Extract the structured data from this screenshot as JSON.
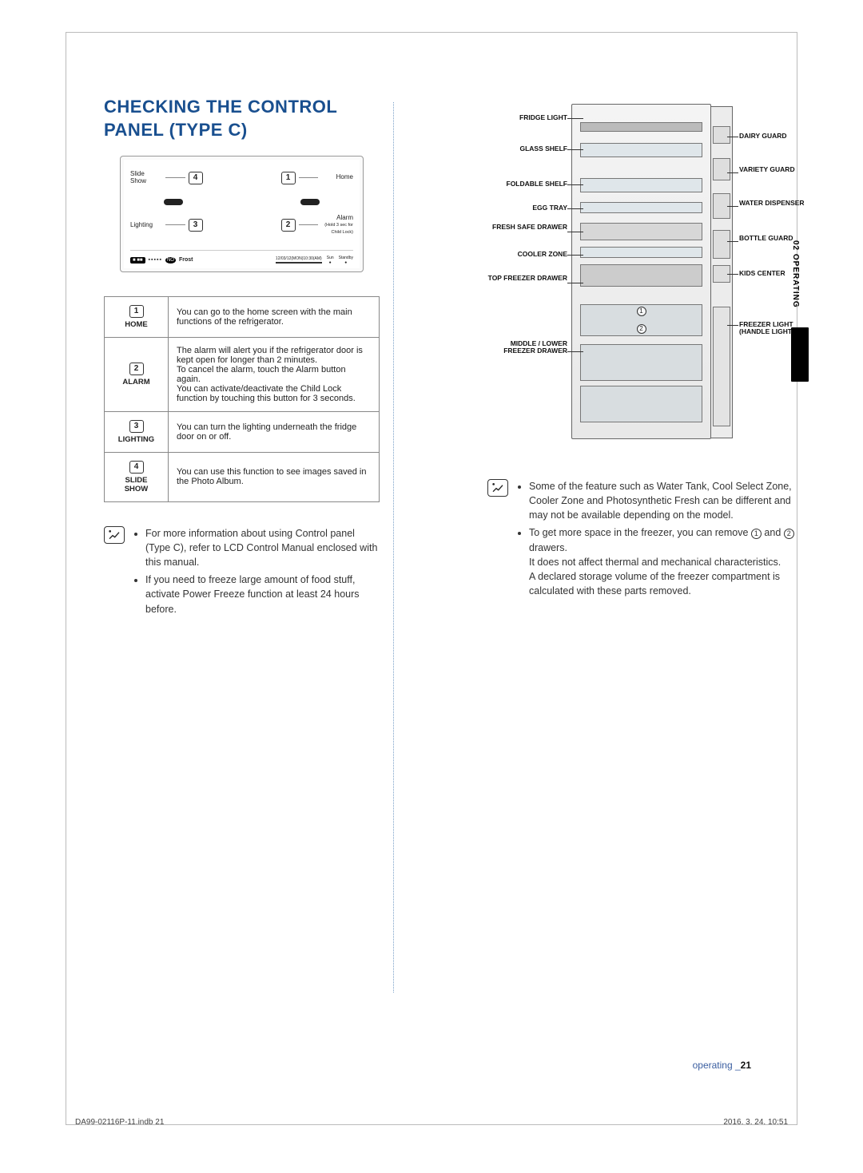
{
  "heading": "CHECKING THE CONTROL PANEL (TYPE C)",
  "panel": {
    "leftTop": "Slide\nShow",
    "leftBottom": "Lighting",
    "rightTop": "Home",
    "rightBottom": "Alarm",
    "rightBottomSub": "(Hold 3 sec for Child Lock)",
    "num1": "1",
    "num2": "2",
    "num3": "3",
    "num4": "4",
    "footerNoFrost": "Frost",
    "footerNoPill": "NO",
    "footerDate": "12/03/12(MON)10:30(AM)",
    "footerSun": "Sun",
    "footerStandby": "Standby"
  },
  "table": {
    "r1": {
      "num": "1",
      "name": "HOME",
      "desc": "You can go to the home screen with the main functions of the refrigerator."
    },
    "r2": {
      "num": "2",
      "name": "ALARM",
      "desc": "The alarm will alert you if the refrigerator door is kept open for longer than 2 minutes.\nTo cancel the alarm, touch the Alarm button again.\nYou can activate/deactivate the Child Lock function by touching this button for 3 seconds."
    },
    "r3": {
      "num": "3",
      "name": "LIGHTING",
      "desc": "You can turn the lighting underneath the fridge door on or off."
    },
    "r4": {
      "num": "4",
      "name": "SLIDE SHOW",
      "desc": "You can use this function to see images saved in the Photo Album."
    }
  },
  "leftNotes": {
    "n1": "For more information about using Control panel (Type C), refer to LCD Control Manual enclosed with this manual.",
    "n2": "If you need to freeze large amount of food stuff, activate Power Freeze function at least 24 hours before."
  },
  "fridgeLabels": {
    "fridgeLight": "FRIDGE LIGHT",
    "glassShelf": "GLASS SHELF",
    "foldableShelf": "FOLDABLE SHELF",
    "eggTray": "EGG TRAY",
    "freshSafe": "FRESH SAFE DRAWER",
    "coolerZone": "COOLER ZONE",
    "topFreezer": "TOP FREEZER DRAWER",
    "midLower": "MIDDLE / LOWER FREEZER DRAWER",
    "dairy": "DAIRY GUARD",
    "variety": "VARIETY GUARD",
    "water": "WATER DISPENSER",
    "bottle": "BOTTLE GUARD",
    "kids": "KIDS CENTER",
    "freezerLight": "FREEZER LIGHT (HANDLE LIGHTING)"
  },
  "rightNotes": {
    "n1": "Some of the feature such as Water Tank, Cool Select Zone, Cooler Zone and Photosynthetic Fresh can be different and may not be available depending on the model.",
    "n2a": "To get more space in the freezer, you can remove ",
    "n2b": " and ",
    "n2c": " drawers.",
    "n2d": "It does not affect thermal and mechanical characteristics.",
    "n2e": "A declared storage volume of the freezer compartment is calculated with these parts removed.",
    "circ1": "1",
    "circ2": "2"
  },
  "sideTab": "02  OPERATING",
  "footerRight": {
    "word": "operating _",
    "num": "21"
  },
  "printFooter": {
    "left": "DA99-02116P-11.indb   21",
    "right": "2016. 3. 24.     10:51"
  }
}
